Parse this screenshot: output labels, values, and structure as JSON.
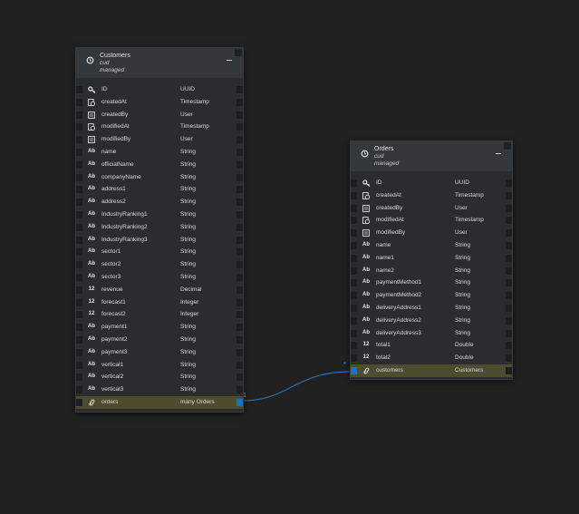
{
  "customers": {
    "title": "Customers",
    "sub1": "cud",
    "sub2": "managed",
    "fields": [
      {
        "icon": "key-icon",
        "name": "ID",
        "type": "UUID"
      },
      {
        "icon": "clock-doc-icon",
        "name": "createdAt",
        "type": "Timestamp"
      },
      {
        "icon": "user-doc-icon",
        "name": "createdBy",
        "type": "User"
      },
      {
        "icon": "clock-doc-icon",
        "name": "modifiedAt",
        "type": "Timestamp"
      },
      {
        "icon": "user-doc-icon",
        "name": "modifiedBy",
        "type": "User"
      },
      {
        "icon": "string-icon",
        "badge": "Ab",
        "name": "name",
        "type": "String"
      },
      {
        "icon": "string-icon",
        "badge": "Ab",
        "name": "officialName",
        "type": "String"
      },
      {
        "icon": "string-icon",
        "badge": "Ab",
        "name": "companyName",
        "type": "String"
      },
      {
        "icon": "string-icon",
        "badge": "Ab",
        "name": "address1",
        "type": "String"
      },
      {
        "icon": "string-icon",
        "badge": "Ab",
        "name": "address2",
        "type": "String"
      },
      {
        "icon": "string-icon",
        "badge": "Ab",
        "name": "IndustryRanking1",
        "type": "String"
      },
      {
        "icon": "string-icon",
        "badge": "Ab",
        "name": "IndustryRanking2",
        "type": "String"
      },
      {
        "icon": "string-icon",
        "badge": "Ab",
        "name": "IndustryRanking3",
        "type": "String"
      },
      {
        "icon": "string-icon",
        "badge": "Ab",
        "name": "sector1",
        "type": "String"
      },
      {
        "icon": "string-icon",
        "badge": "Ab",
        "name": "sector2",
        "type": "String"
      },
      {
        "icon": "string-icon",
        "badge": "Ab",
        "name": "sector3",
        "type": "String"
      },
      {
        "icon": "number-icon",
        "badge": "12",
        "name": "revenue",
        "type": "Decimal"
      },
      {
        "icon": "number-icon",
        "badge": "12",
        "name": "forecast1",
        "type": "Integer"
      },
      {
        "icon": "number-icon",
        "badge": "12",
        "name": "forecast2",
        "type": "Integer"
      },
      {
        "icon": "string-icon",
        "badge": "Ab",
        "name": "payment1",
        "type": "String"
      },
      {
        "icon": "string-icon",
        "badge": "Ab",
        "name": "payment2",
        "type": "String"
      },
      {
        "icon": "string-icon",
        "badge": "Ab",
        "name": "payment3",
        "type": "String"
      },
      {
        "icon": "string-icon",
        "badge": "Ab",
        "name": "vertical1",
        "type": "String"
      },
      {
        "icon": "string-icon",
        "badge": "Ab",
        "name": "vertical2",
        "type": "String"
      },
      {
        "icon": "string-icon",
        "badge": "Ab",
        "name": "vertical3",
        "type": "String"
      },
      {
        "icon": "link-icon",
        "name": "orders",
        "type": "many Orders",
        "selected": true
      }
    ]
  },
  "orders": {
    "title": "Orders",
    "sub1": "cud",
    "sub2": "managed",
    "fields": [
      {
        "icon": "key-icon",
        "name": "ID",
        "type": "UUID"
      },
      {
        "icon": "clock-doc-icon",
        "name": "createdAt",
        "type": "Timestamp"
      },
      {
        "icon": "user-doc-icon",
        "name": "createdBy",
        "type": "User"
      },
      {
        "icon": "clock-doc-icon",
        "name": "modifiedAt",
        "type": "Timestamp"
      },
      {
        "icon": "user-doc-icon",
        "name": "modifiedBy",
        "type": "User"
      },
      {
        "icon": "string-icon",
        "badge": "Ab",
        "name": "name",
        "type": "String"
      },
      {
        "icon": "string-icon",
        "badge": "Ab",
        "name": "name1",
        "type": "String"
      },
      {
        "icon": "string-icon",
        "badge": "Ab",
        "name": "name2",
        "type": "String"
      },
      {
        "icon": "string-icon",
        "badge": "Ab",
        "name": "paymentMethod1",
        "type": "String"
      },
      {
        "icon": "string-icon",
        "badge": "Ab",
        "name": "paymentMethod2",
        "type": "String"
      },
      {
        "icon": "string-icon",
        "badge": "Ab",
        "name": "deliveryAddress1",
        "type": "String"
      },
      {
        "icon": "string-icon",
        "badge": "Ab",
        "name": "deliveryAddress2",
        "type": "String"
      },
      {
        "icon": "string-icon",
        "badge": "Ab",
        "name": "deliveryAddress3",
        "type": "String"
      },
      {
        "icon": "number-icon",
        "badge": "12",
        "name": "total1",
        "type": "Double"
      },
      {
        "icon": "number-icon",
        "badge": "12",
        "name": "total2",
        "type": "Double"
      },
      {
        "icon": "link-icon",
        "name": "customers",
        "type": "Customers",
        "selected": true
      }
    ]
  },
  "association": {
    "source_cardinality": "1",
    "target_cardinality": "*",
    "line_color": "#2f78b8"
  },
  "colors": {
    "canvas": "#212121",
    "selected_row": "#4e4c2f",
    "connector": "#1575c9"
  }
}
